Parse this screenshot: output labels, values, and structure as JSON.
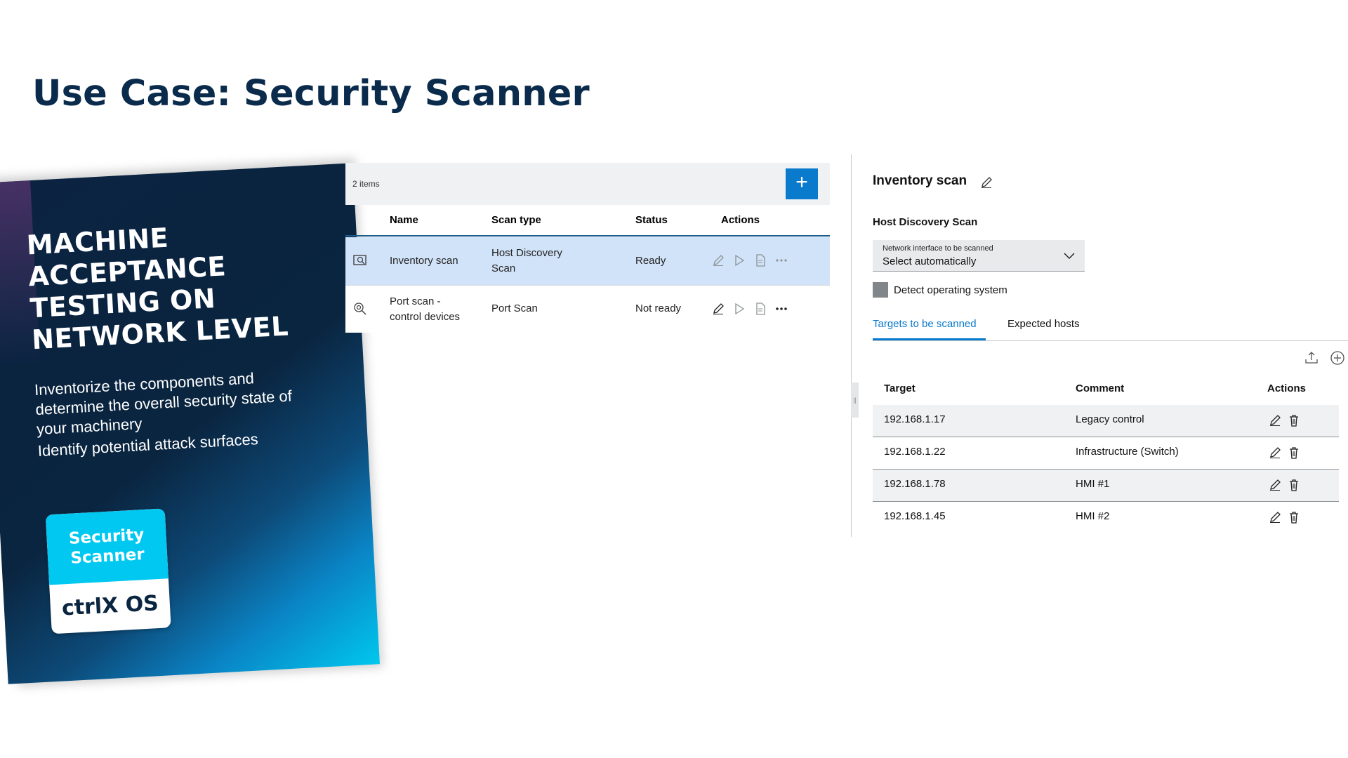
{
  "page": {
    "title": "Use Case: Security Scanner"
  },
  "brochure": {
    "headline_lines": [
      "MACHINE",
      "ACCEPTANCE",
      "TESTING ON",
      "NETWORK LEVEL"
    ],
    "description": "Inventorize the components and determine the overall security state of your machinery",
    "bullet": "Identify potential attack surfaces",
    "app_tile": {
      "line1": "Security",
      "line2": "Scanner",
      "brand": "ctrlX OS"
    },
    "colors": {
      "dark": "#0a2540",
      "accent": "#00c8f0"
    }
  },
  "scan_list": {
    "items_count": "2 items",
    "add_button": "+",
    "columns": {
      "name": "Name",
      "scan_type": "Scan type",
      "status": "Status",
      "actions": "Actions"
    },
    "rows": [
      {
        "icon": "inventory-scan-icon",
        "name": "Inventory scan",
        "name_line2": "",
        "scan_type": "Host Discovery",
        "scan_type_line2": "Scan",
        "status": "Ready",
        "selected": true
      },
      {
        "icon": "port-scan-icon",
        "name": "Port scan -",
        "name_line2": "control devices",
        "scan_type": "Port Scan",
        "scan_type_line2": "",
        "status": "Not ready",
        "selected": false
      }
    ],
    "row_actions": [
      "edit-icon",
      "play-icon",
      "report-icon",
      "more-icon"
    ]
  },
  "detail": {
    "title": "Inventory scan",
    "subtitle": "Host Discovery Scan",
    "network_select": {
      "label": "Network interface to be scanned",
      "value": "Select automatically"
    },
    "detect_os_label": "Detect operating system",
    "tabs": {
      "active": "Targets to be scanned",
      "inactive": "Expected hosts"
    },
    "targets": {
      "columns": {
        "target": "Target",
        "comment": "Comment",
        "actions": "Actions"
      },
      "rows": [
        {
          "target": "192.168.1.17",
          "comment": "Legacy control"
        },
        {
          "target": "192.168.1.22",
          "comment": "Infrastructure (Switch)"
        },
        {
          "target": "192.168.1.78",
          "comment": "HMI #1"
        },
        {
          "target": "192.168.1.45",
          "comment": "HMI #2"
        }
      ]
    }
  },
  "colors": {
    "primary": "#0a7acd",
    "selected_row": "#d1e3f8",
    "title": "#0a2b4c"
  }
}
